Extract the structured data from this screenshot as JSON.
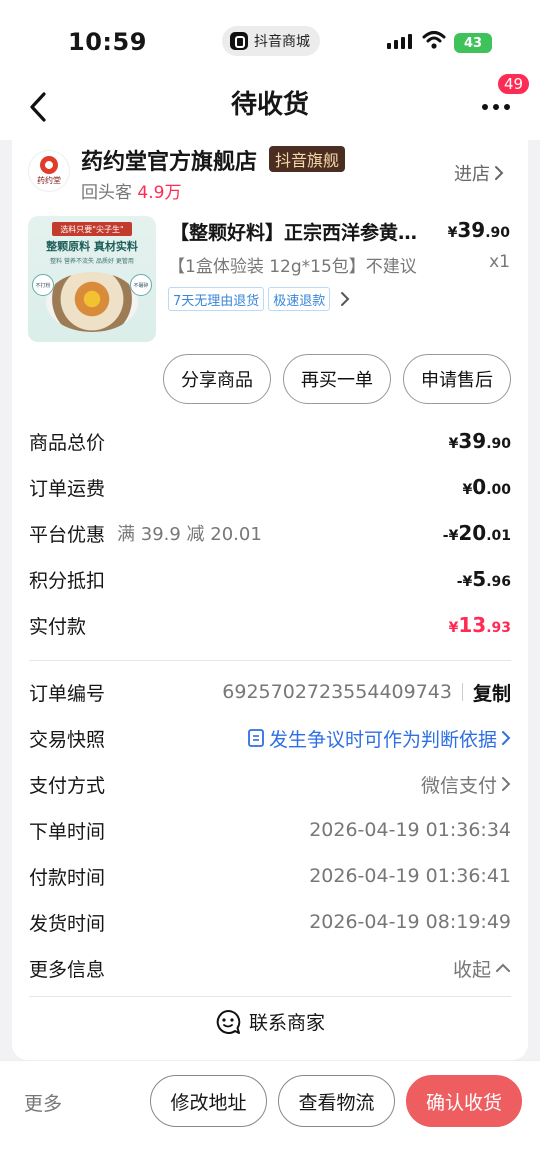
{
  "status_bar": {
    "time": "10:59",
    "app_pill": "抖音商城",
    "battery": "43"
  },
  "nav": {
    "title": "待收货",
    "more_badge": "49"
  },
  "shop": {
    "logo_text": "药约堂",
    "name": "药约堂官方旗舰店",
    "tag": "抖音旗舰",
    "repeat_label": "回头客",
    "repeat_value": "4.9万",
    "enter_label": "进店"
  },
  "product": {
    "image_band": "选料只要\"尖子生\"",
    "image_slogan": "整颗原料 真材实料",
    "image_sub": "整料 营养不流失 品质好 更管用",
    "image_tag_left": "不打粉",
    "image_tag_right": "不碾碎",
    "title": "【整颗好料】正宗西洋参黄…",
    "price_currency": "¥",
    "price_int": "39",
    "price_dec": ".90",
    "spec": "【1盒体验装 12g*15包】不建议",
    "qty": "x1",
    "chips": [
      "7天无理由退货",
      "极速退款"
    ]
  },
  "actions": {
    "share": "分享商品",
    "rebuy": "再买一单",
    "after_sale": "申请售后"
  },
  "summary": {
    "total_label": "商品总价",
    "total_prefix": "¥",
    "total_int": "39",
    "total_dec": ".90",
    "shipping_label": "订单运费",
    "shipping_prefix": "¥",
    "shipping_int": "0",
    "shipping_dec": ".00",
    "discount_label": "平台优惠",
    "discount_note": "满 39.9 减 20.01",
    "discount_prefix": "-¥",
    "discount_int": "20",
    "discount_dec": ".01",
    "points_label": "积分抵扣",
    "points_prefix": "-¥",
    "points_int": "5",
    "points_dec": ".96",
    "paid_label": "实付款",
    "paid_prefix": "¥",
    "paid_int": "13",
    "paid_dec": ".93"
  },
  "order_info": {
    "order_no_label": "订单编号",
    "order_no": "6925702723554409743",
    "copy": "复制",
    "snapshot_label": "交易快照",
    "snapshot_value": "发生争议时可作为判断依据",
    "pay_method_label": "支付方式",
    "pay_method": "微信支付",
    "order_time_label": "下单时间",
    "order_time": "2026-04-19 01:36:34",
    "pay_time_label": "付款时间",
    "pay_time": "2026-04-19 01:36:41",
    "ship_time_label": "发货时间",
    "ship_time": "2026-04-19 08:19:49",
    "more_info_label": "更多信息",
    "collapse": "收起"
  },
  "contact": {
    "label": "联系商家"
  },
  "bottom": {
    "more": "更多",
    "modify_address": "修改地址",
    "view_logistics": "查看物流",
    "confirm_receipt": "确认收货"
  },
  "colors": {
    "accent_red": "#fe2c55",
    "confirm_button": "#ee5d60",
    "link_blue": "#2f6fe4"
  }
}
